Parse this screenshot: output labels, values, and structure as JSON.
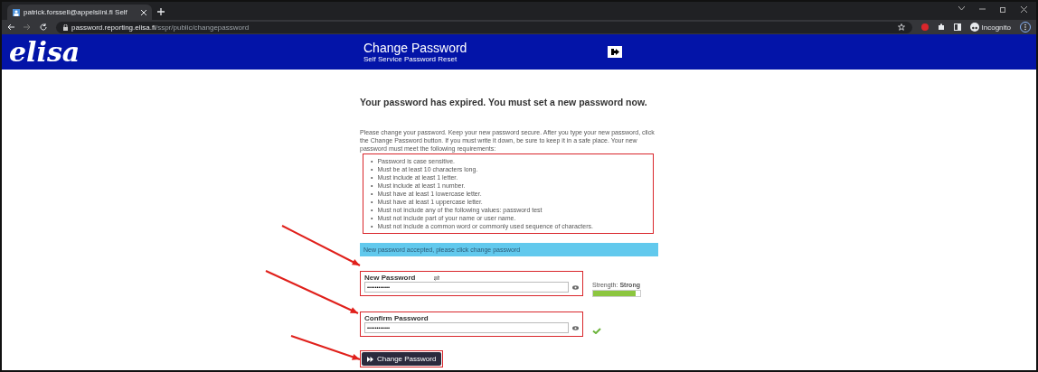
{
  "browser": {
    "tab_title": "patrick.forssell@appelsiini.fi Self",
    "url_host": "password.reporting.elisa.fi",
    "url_path": "/sspr/public/changepassword",
    "profile": "Incognito"
  },
  "banner": {
    "logo": "elisa",
    "title": "Change Password",
    "subtitle": "Self Service Password Reset"
  },
  "headline": "Your password has expired. You must set a new password now.",
  "intro": "Please change your password. Keep your new password secure. After you type your new password, click the Change Password button. If you must write it down, be sure to keep it in a safe place. Your new password must meet the following requirements:",
  "bullet": "•",
  "requirements": [
    "Password is case sensitive.",
    "Must be at least 10 characters long.",
    "Must include at least 1 letter.",
    "Must include at least 1 number.",
    "Must have at least 1 lowercase letter.",
    "Must have at least 1 uppercase letter.",
    "Must not include any of the following values:  password test",
    "Must not include part of your name or user name.",
    "Must not include a common word or commonly used sequence of characters."
  ],
  "message": "New password accepted, please click change password",
  "new_password": {
    "label": "New Password",
    "value": "••••••••••••",
    "strength_label": "Strength:",
    "strength": "Strong",
    "level": 0.9
  },
  "confirm_password": {
    "label": "Confirm Password",
    "value": "••••••••••••",
    "matches": true
  },
  "button": "Change Password"
}
